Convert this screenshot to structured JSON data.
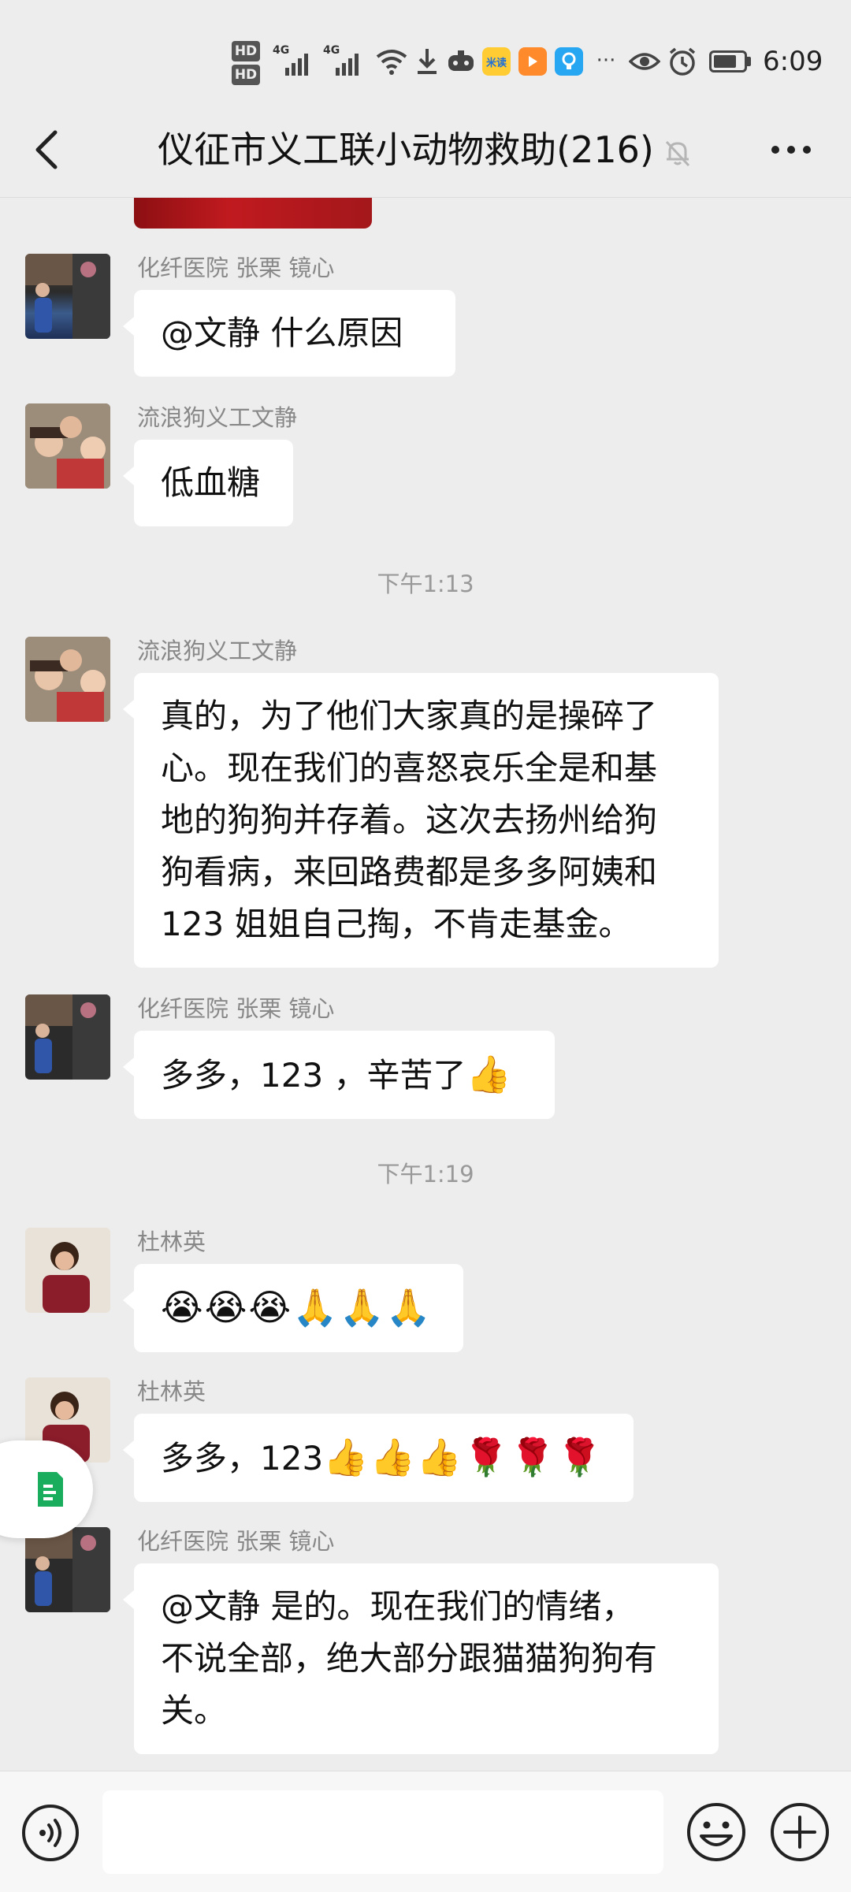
{
  "status_bar": {
    "time": "6:09",
    "hd1": "HD",
    "hd2": "HD",
    "network1": "4G",
    "network2": "4G",
    "app_badge": "米读",
    "icons": [
      "hd-icon",
      "signal-icon",
      "signal-icon",
      "wifi-icon",
      "download-icon",
      "game-icon",
      "mi-read-app-icon",
      "video-app-icon",
      "bulb-app-icon",
      "more-notifications-icon",
      "eye-icon",
      "alarm-icon",
      "battery-icon"
    ]
  },
  "header": {
    "title": "仪征市义工联小动物救助(216)",
    "icons": [
      "back-arrow-icon",
      "mute-bell-icon",
      "more-dots-icon"
    ]
  },
  "messages": [
    {
      "sender": "化纤医院 张栗 镜心",
      "text": "@文静  什么原因",
      "avatar": "avatar-jingxin"
    },
    {
      "sender": "流浪狗义工文静",
      "text": "低血糖",
      "avatar": "avatar-wenjing"
    },
    {
      "timestamp": "下午1:13"
    },
    {
      "sender": "流浪狗义工文静",
      "lines": [
        "真的，为了他们大家真的是操碎了",
        "心。现在我们的喜怒哀乐全是和基",
        "地的狗狗并存着。这次去扬州给狗",
        "狗看病，来回路费都是多多阿姨和",
        "123 姐姐自己掏，不肯走基金。"
      ],
      "avatar": "avatar-wenjing"
    },
    {
      "sender": "化纤医院 张栗 镜心",
      "text": "多多，123 ，辛苦了",
      "emoji": "👍",
      "avatar": "avatar-jingxin"
    },
    {
      "timestamp": "下午1:19"
    },
    {
      "sender": "杜林英",
      "emoji": "😭😭😭🙏🙏🙏",
      "avatar": "avatar-dulinying"
    },
    {
      "sender": "杜林英",
      "text": "多多，123",
      "emoji": "👍👍👍🌹🌹🌹",
      "avatar": "avatar-dulinying"
    },
    {
      "sender": "化纤医院 张栗 镜心",
      "lines": [
        "@文静  是的。现在我们的情绪，",
        "不说全部，绝大部分跟猫猫狗狗有",
        "关。"
      ],
      "avatar": "avatar-jingxin"
    }
  ],
  "input": {
    "value": "",
    "placeholder": ""
  },
  "colors": {
    "background": "#ededed",
    "bubble": "#ffffff",
    "secondary_text": "#888888",
    "float_tab_accent": "#1aad5e"
  }
}
